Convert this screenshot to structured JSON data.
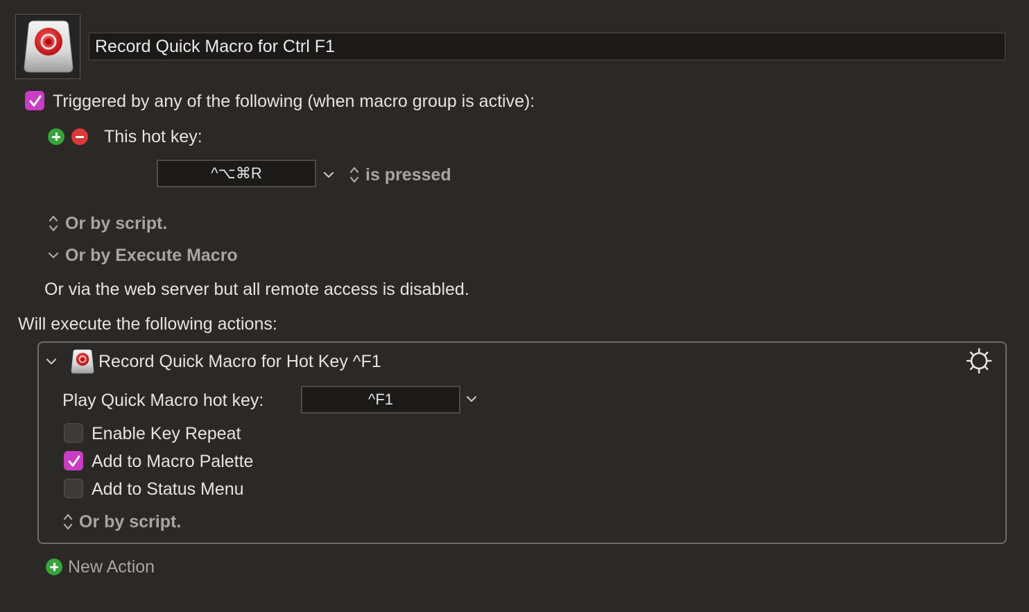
{
  "macro": {
    "name": "Record Quick Macro for Ctrl F1",
    "icon": "record-button-icon"
  },
  "triggers": {
    "enabled": true,
    "heading": "Triggered by any of the following (when macro group is active):",
    "hotkey_label": "This hot key:",
    "hotkey_value": "^⌥⌘R",
    "hotkey_condition": "is pressed",
    "or_by_script": "Or by script.",
    "or_by_execute_macro": "Or by Execute Macro",
    "web_server_note": "Or via the web server but all remote access is disabled."
  },
  "actions": {
    "heading": "Will execute the following actions:",
    "items": [
      {
        "title": "Record Quick Macro for Hot Key ^F1",
        "play_hotkey_label": "Play Quick Macro hot key:",
        "play_hotkey_value": "^F1",
        "options": [
          {
            "label": "Enable Key Repeat",
            "checked": false
          },
          {
            "label": "Add to Macro Palette",
            "checked": true
          },
          {
            "label": "Add to Status Menu",
            "checked": false
          }
        ],
        "or_by_script": "Or by script."
      }
    ],
    "new_action_label": "New Action"
  },
  "colors": {
    "background": "#2b2826",
    "checkbox_accent": "#c93cc3",
    "add_green": "#37a33c",
    "remove_red": "#d83a3a"
  }
}
